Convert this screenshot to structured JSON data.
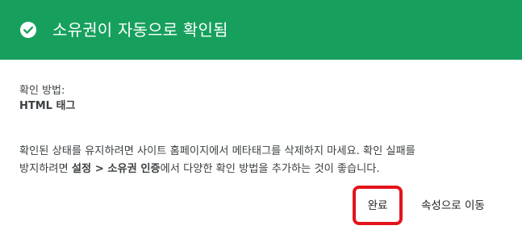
{
  "header": {
    "title": "소유권이 자동으로 확인됨",
    "icon": "check-circle-icon",
    "color": "#17a05d"
  },
  "verification": {
    "method_label": "확인 방법:",
    "method_value": "HTML 태그"
  },
  "message": {
    "line1": "확인된 상태를 유지하려면 사이트 홈페이지에서 메타태그를 삭제하지 마세요. 확인 실패를",
    "line2_prefix": "방지하려면 ",
    "line2_bold1": "설정",
    "line2_sep": " > ",
    "line2_bold2": "소유권 인증",
    "line2_suffix": "에서 다양한 확인 방법을 추가하는 것이 좋습니다."
  },
  "actions": {
    "done_label": "완료",
    "go_to_property_label": "속성으로 이동",
    "highlight_color": "#e4131b"
  }
}
